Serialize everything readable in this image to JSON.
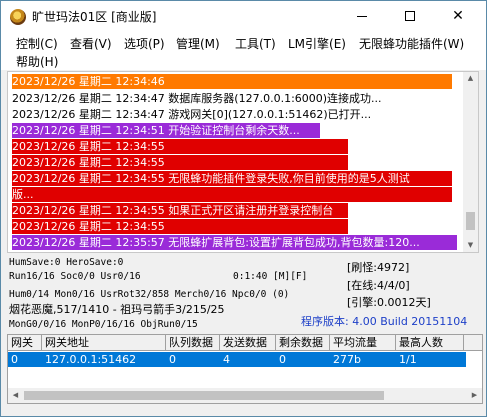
{
  "window": {
    "title": "旷世玛法01区 [商业版]",
    "icon": "game-logo-icon",
    "controls": {
      "minimize": "minimize-icon",
      "maximize": "maximize-icon",
      "close": "✕"
    }
  },
  "menu": {
    "items": [
      "控制(C)",
      "查看(V)",
      "选项(P)",
      "管理(M)",
      "工具(T)",
      "LM引擎(E)",
      "无限蜂功能插件(W)",
      "帮助(H)"
    ]
  },
  "log": {
    "lines": [
      {
        "text": "2023/12/26 星期二 12:34:46",
        "style": "orange"
      },
      {
        "text": "2023/12/26 星期二 12:34:47 数据库服务器(127.0.0.1:6000)连接成功...",
        "style": "plain"
      },
      {
        "text": "2023/12/26 星期二 12:34:47 游戏网关[0](127.0.0.1:51462)已打开...",
        "style": "plain"
      },
      {
        "text": "2023/12/26 星期二 12:34:51 开始验证控制台剩余天数...",
        "style": "purple"
      },
      {
        "text": "2023/12/26 星期二 12:34:55",
        "style": "red"
      },
      {
        "text": "2023/12/26 星期二 12:34:55",
        "style": "red"
      },
      {
        "text": "2023/12/26 星期二 12:34:55 无限蜂功能插件登录失败,你目前使用的是5人测试",
        "style": "red"
      },
      {
        "text": "版...",
        "style": "red"
      },
      {
        "text": "2023/12/26 星期二 12:34:55 如果正式开区请注册并登录控制台",
        "style": "red"
      },
      {
        "text": "2023/12/26 星期二 12:34:55",
        "style": "red"
      },
      {
        "text": "2023/12/26 星期二 12:35:57 无限蜂扩展背包:设置扩展背包成功,背包数量:120...",
        "style": "purple"
      }
    ],
    "scroll_up": "▲",
    "scroll_down": "▼"
  },
  "status": {
    "humsave": "HumSave:0 HeroSave:0",
    "run": "Run16/16 Soc0/0 Usr0/16",
    "timer": "0:1:40 [M][F]",
    "hum": "Hum0/14 Mon0/16 UsrRot32/858 Merch0/16 Npc0/0 (0)",
    "monster": "烟花恶魔,517/1410 - 祖玛弓箭手3/215/25",
    "mon": "MonG0/0/16 MonP0/16/16 ObjRun0/15",
    "refresh": "[刷怪:4972]",
    "online": "[在线:4/4/0]",
    "engine": "[引擎:0.0012天]",
    "version": "程序版本: 4.00 Build 20151104"
  },
  "grid": {
    "headers": [
      "网关",
      "网关地址",
      "队列数据",
      "发送数据",
      "剩余数据",
      "平均流量",
      "最高人数"
    ],
    "rows": [
      [
        "0",
        "127.0.0.1:51462",
        "0",
        "4",
        "0",
        "277b",
        "1/1"
      ]
    ],
    "scroll_left": "◀",
    "scroll_right": "▶"
  }
}
